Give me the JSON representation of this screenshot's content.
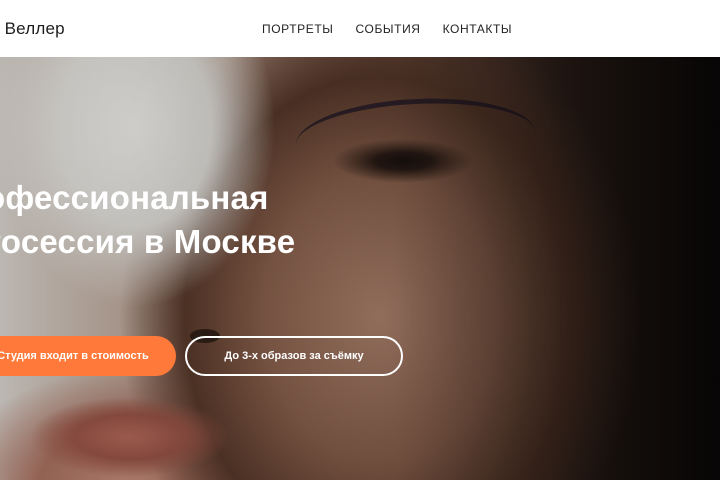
{
  "header": {
    "brand": "а Веллер",
    "nav": [
      {
        "label": "ПОРТРЕТЫ"
      },
      {
        "label": "СОБЫТИЯ"
      },
      {
        "label": "КОНТАКТЫ"
      }
    ]
  },
  "hero": {
    "headline_line1": "офессиональная",
    "headline_line2": "тосессия в Москве",
    "buttons": {
      "primary": "Студия входит в стоимость",
      "secondary": "До 3-х образов за съёмку"
    }
  },
  "colors": {
    "accent": "#ff7a3a",
    "header_bg": "#ffffff",
    "text_dark": "#222222",
    "text_light": "#ffffff"
  }
}
